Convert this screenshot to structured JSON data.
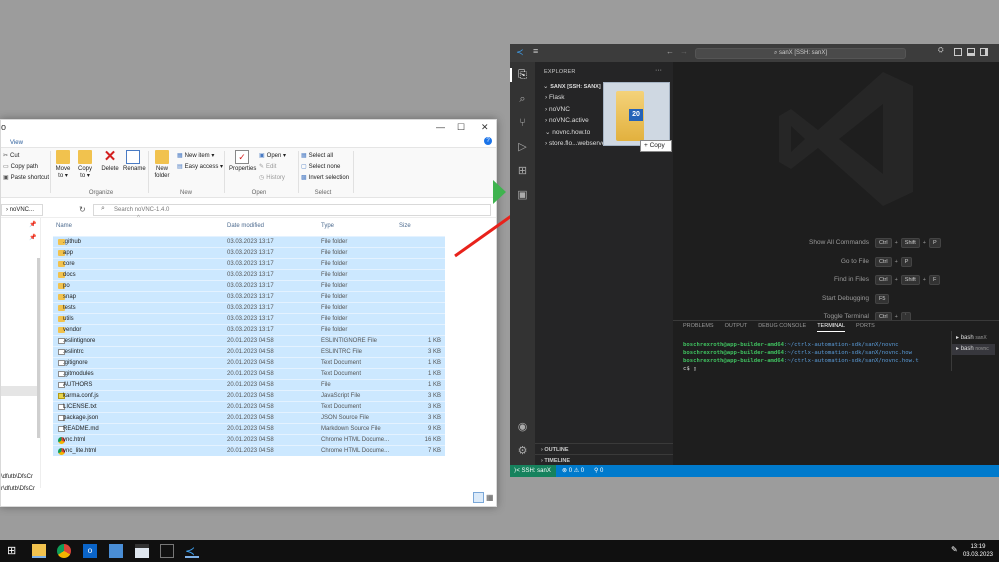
{
  "explorer": {
    "tabs": {
      "view": "View"
    },
    "ribbon": {
      "cut": "Cut",
      "copy_path": "Copy path",
      "paste_shortcut": "Paste shortcut",
      "move_to": "Move\nto ▾",
      "copy_to": "Copy\nto ▾",
      "delete": "Delete",
      "rename": "Rename",
      "new_folder": "New\nfolder",
      "new_item": "New item ▾",
      "easy_access": "Easy access ▾",
      "properties": "Properties",
      "open": "Open ▾",
      "edit": "Edit",
      "history": "History",
      "select_all": "Select all",
      "select_none": "Select none",
      "invert_selection": "Invert selection",
      "groups": {
        "organize": "Organize",
        "new": "New",
        "open": "Open",
        "select": "Select"
      }
    },
    "address": "› noVNC...",
    "search_placeholder": "Search noVNC-1.4.0",
    "columns": {
      "name": "Name",
      "date": "Date modified",
      "type": "Type",
      "size": "Size"
    },
    "nav_left_text": [
      "\\dfutb\\DfsCr",
      "r\\dfutb\\DfsCr"
    ],
    "files": [
      {
        "name": ".github",
        "date": "03.03.2023 13:17",
        "type": "File folder",
        "size": "",
        "icon": "folder"
      },
      {
        "name": "app",
        "date": "03.03.2023 13:17",
        "type": "File folder",
        "size": "",
        "icon": "folder"
      },
      {
        "name": "core",
        "date": "03.03.2023 13:17",
        "type": "File folder",
        "size": "",
        "icon": "folder"
      },
      {
        "name": "docs",
        "date": "03.03.2023 13:17",
        "type": "File folder",
        "size": "",
        "icon": "folder"
      },
      {
        "name": "po",
        "date": "03.03.2023 13:17",
        "type": "File folder",
        "size": "",
        "icon": "folder"
      },
      {
        "name": "snap",
        "date": "03.03.2023 13:17",
        "type": "File folder",
        "size": "",
        "icon": "folder"
      },
      {
        "name": "tests",
        "date": "03.03.2023 13:17",
        "type": "File folder",
        "size": "",
        "icon": "folder"
      },
      {
        "name": "utils",
        "date": "03.03.2023 13:17",
        "type": "File folder",
        "size": "",
        "icon": "folder"
      },
      {
        "name": "vendor",
        "date": "03.03.2023 13:17",
        "type": "File folder",
        "size": "",
        "icon": "folder"
      },
      {
        "name": ".eslintignore",
        "date": "20.01.2023 04:58",
        "type": "ESLINTIGNORE File",
        "size": "1 KB",
        "icon": "doc"
      },
      {
        "name": ".eslintrc",
        "date": "20.01.2023 04:58",
        "type": "ESLINTRC File",
        "size": "3 KB",
        "icon": "doc"
      },
      {
        "name": ".gitignore",
        "date": "20.01.2023 04:58",
        "type": "Text Document",
        "size": "1 KB",
        "icon": "doc"
      },
      {
        "name": ".gitmodules",
        "date": "20.01.2023 04:58",
        "type": "Text Document",
        "size": "1 KB",
        "icon": "doc"
      },
      {
        "name": "AUTHORS",
        "date": "20.01.2023 04:58",
        "type": "File",
        "size": "1 KB",
        "icon": "doc"
      },
      {
        "name": "karma.conf.js",
        "date": "20.01.2023 04:58",
        "type": "JavaScript File",
        "size": "3 KB",
        "icon": "js"
      },
      {
        "name": "LICENSE.txt",
        "date": "20.01.2023 04:58",
        "type": "Text Document",
        "size": "3 KB",
        "icon": "doc"
      },
      {
        "name": "package.json",
        "date": "20.01.2023 04:58",
        "type": "JSON Source File",
        "size": "3 KB",
        "icon": "doc"
      },
      {
        "name": "README.md",
        "date": "20.01.2023 04:58",
        "type": "Markdown Source File",
        "size": "9 KB",
        "icon": "doc"
      },
      {
        "name": "vnc.html",
        "date": "20.01.2023 04:58",
        "type": "Chrome HTML Docume...",
        "size": "16 KB",
        "icon": "chrome"
      },
      {
        "name": "vnc_lite.html",
        "date": "20.01.2023 04:58",
        "type": "Chrome HTML Docume...",
        "size": "7 KB",
        "icon": "chrome"
      }
    ]
  },
  "vscode": {
    "command_center": "⌕ sanX [SSH: sanX]",
    "explorer_header": "EXPLORER",
    "more": "···",
    "root": "SANX [SSH: SANX]",
    "tree": [
      "Flask",
      "noVNC",
      "noVNC.active",
      "novnc.how.to",
      "store.flo...webserver"
    ],
    "hints": [
      {
        "label": "Show All Commands",
        "keys": [
          "Ctrl",
          "+",
          "Shift",
          "+",
          "P"
        ]
      },
      {
        "label": "Go to File",
        "keys": [
          "Ctrl",
          "+",
          "P"
        ]
      },
      {
        "label": "Find in Files",
        "keys": [
          "Ctrl",
          "+",
          "Shift",
          "+",
          "F"
        ]
      },
      {
        "label": "Start Debugging",
        "keys": [
          "F5"
        ]
      },
      {
        "label": "Toggle Terminal",
        "keys": [
          "Ctrl",
          "+",
          "`"
        ]
      }
    ],
    "panel_tabs": [
      "PROBLEMS",
      "OUTPUT",
      "DEBUG CONSOLE",
      "TERMINAL",
      "PORTS"
    ],
    "terminal": [
      {
        "user": "boschrexroth@app-builder-amd64",
        "path": ":~/ctrlx-automation-sdk/sanX/novnc"
      },
      {
        "user": "boschrexroth@app-builder-amd64",
        "path": ":~/ctrlx-automation-sdk/sanX/novnc.how"
      },
      {
        "user": "boschrexroth@app-builder-amd64",
        "path": ":~/ctrlx-automation-sdk/sanX/novnc.how.t"
      }
    ],
    "prompt": "c$ ▯",
    "shells": [
      {
        "name": "bash",
        "suffix": "sanX"
      },
      {
        "name": "bash",
        "suffix": "novnc"
      }
    ],
    "outline": "OUTLINE",
    "timeline": "TIMELINE",
    "status": {
      "remote": "⟩< SSH: sanX",
      "problems": "⊗ 0 ⚠ 0",
      "ports": "⚲ 0"
    }
  },
  "drag": {
    "badge": "20",
    "tooltip": "+ Copy"
  },
  "taskbar": {
    "time": "13:19",
    "date": "03.03.2023"
  },
  "colors": {
    "selection": "#cce8ff",
    "vscode_blue": "#007acc",
    "remote_green": "#16825d",
    "arrow": "#e8221b"
  }
}
